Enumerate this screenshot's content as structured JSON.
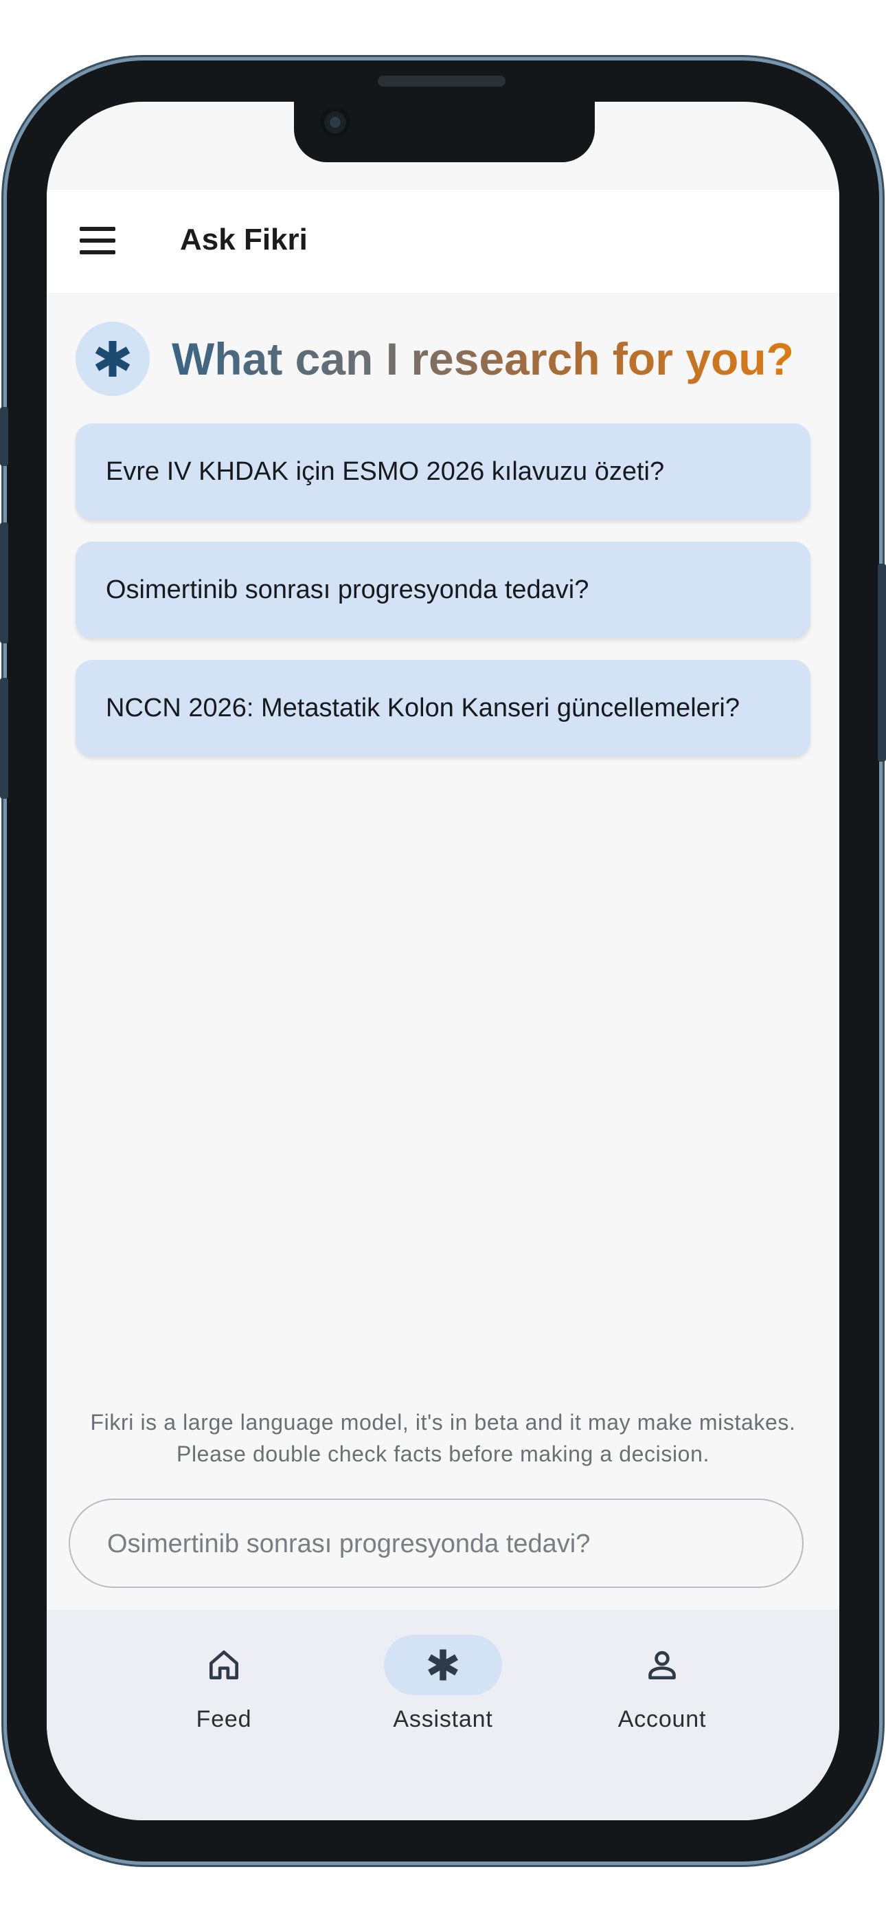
{
  "app_bar": {
    "title": "Ask Fikri"
  },
  "hero": {
    "title": "What can I research for you?"
  },
  "suggestions": [
    "Evre IV KHDAK için ESMO 2026 kılavuzu özeti?",
    "Osimertinib sonrası progresyonda tedavi?",
    "NCCN 2026: Metastatik Kolon Kanseri güncellemeleri?"
  ],
  "disclaimer": {
    "line1": "Fikri is a large language model, it's in beta and it may make mistakes.",
    "line2": "Please double check facts before making a decision."
  },
  "input": {
    "placeholder": "Osimertinib sonrası progresyonda tedavi?",
    "value": ""
  },
  "bottom_nav": {
    "items": [
      {
        "label": "Feed",
        "icon": "home-icon",
        "active": false
      },
      {
        "label": "Assistant",
        "icon": "asterisk-icon",
        "active": true
      },
      {
        "label": "Account",
        "icon": "person-icon",
        "active": false
      }
    ]
  },
  "colors": {
    "accent_blue": "#d4e2f5",
    "icon_dark_blue": "#1d4a70",
    "title_gradient_start": "#3a6585",
    "title_gradient_end": "#dd7a12",
    "nav_background": "#eceef3"
  }
}
